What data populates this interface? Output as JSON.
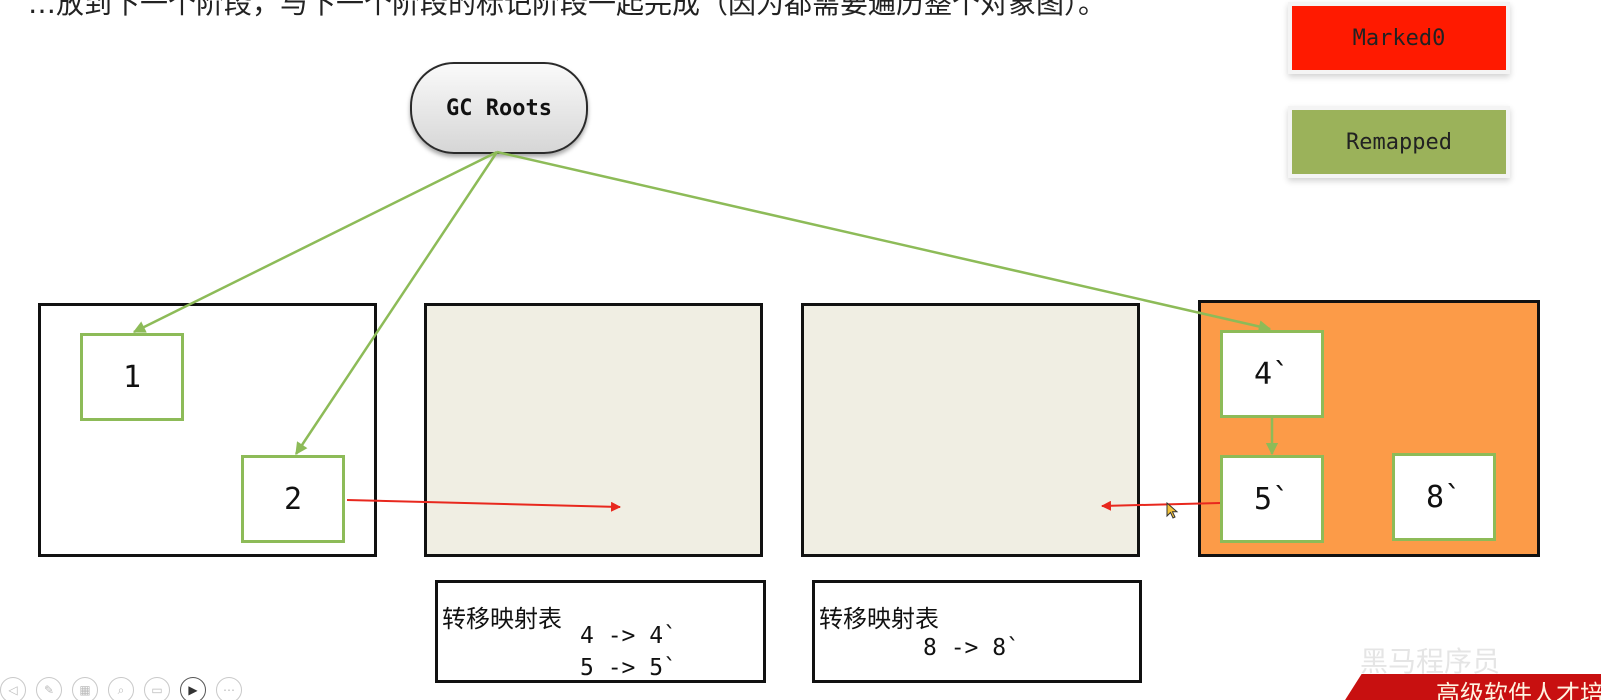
{
  "caption_clipped": "…放到下一个阶段，与下一个阶段的标记阶段一起完成（因为都需要遍历整个对象图）。",
  "legend": {
    "marked": {
      "label": "Marked0",
      "color": "#ff1a00"
    },
    "remapped": {
      "label": "Remapped",
      "color": "#9bb25a"
    }
  },
  "gc_roots": {
    "label": "GC Roots"
  },
  "objects": {
    "o1": "1",
    "o2": "2",
    "o4": "4`",
    "o5": "5`",
    "o8": "8`"
  },
  "forwarding_tables": {
    "left": {
      "title": "转移映射表",
      "rows": [
        "4 -> 4`",
        "5 -> 5`"
      ]
    },
    "right": {
      "title": "转移映射表",
      "rows": [
        "8 -> 8`"
      ]
    }
  },
  "colors": {
    "reference_edge": "#8dbb58",
    "remap_edge": "#e8281e",
    "relocated_region": "#fc9b48",
    "empty_region": "#f0eee3"
  },
  "watermark": {
    "brand": "黑马程序员",
    "banner": "高级软件人才培"
  },
  "toolbar_icons": [
    "arrow-icon",
    "pen-icon",
    "save-icon",
    "zoom-icon",
    "screen-icon",
    "video-icon",
    "more-icon"
  ]
}
